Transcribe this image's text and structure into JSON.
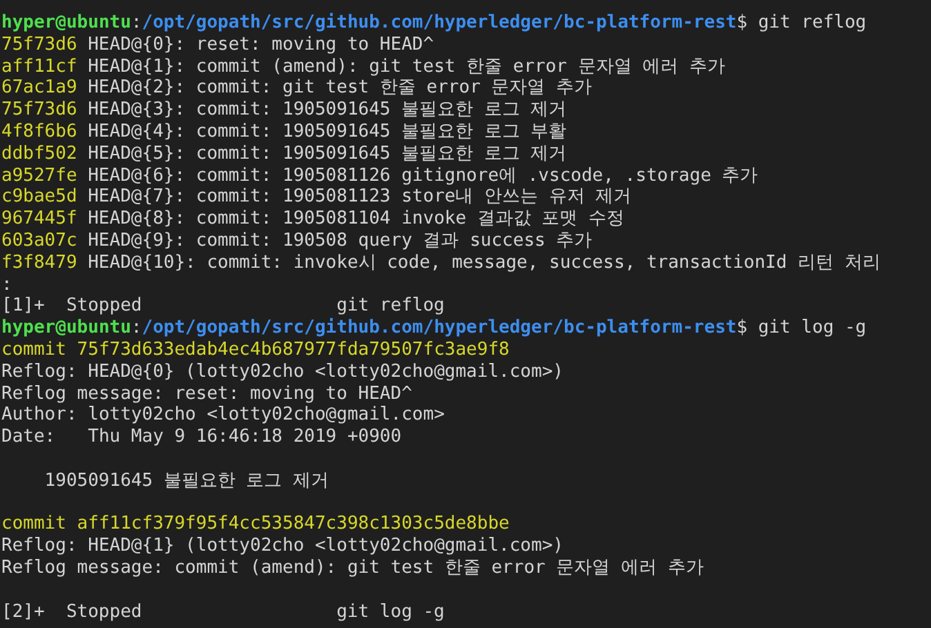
{
  "lines": [
    {
      "kind": "prompt",
      "user_host": "hyper@ubuntu",
      "separator": ":",
      "path": "/opt/gopath/src/github.com/hyperledger/bc-platform-rest",
      "symbol": "$",
      "command": "git reflog"
    },
    {
      "kind": "reflog",
      "hash": "75f73d6",
      "text": "HEAD@{0}: reset: moving to HEAD^"
    },
    {
      "kind": "reflog",
      "hash": "aff11cf",
      "text": "HEAD@{1}: commit (amend): git test 한줄 error 문자열 에러 추가"
    },
    {
      "kind": "reflog",
      "hash": "67ac1a9",
      "text": "HEAD@{2}: commit: git test 한줄 error 문자열 추가"
    },
    {
      "kind": "reflog",
      "hash": "75f73d6",
      "text": "HEAD@{3}: commit: 1905091645 불필요한 로그 제거"
    },
    {
      "kind": "reflog",
      "hash": "4f8f6b6",
      "text": "HEAD@{4}: commit: 1905091645 불필요한 로그 부활"
    },
    {
      "kind": "reflog",
      "hash": "ddbf502",
      "text": "HEAD@{5}: commit: 1905091645 불필요한 로그 제거"
    },
    {
      "kind": "reflog",
      "hash": "a9527fe",
      "text": "HEAD@{6}: commit: 1905081126 gitignore에 .vscode, .storage 추가"
    },
    {
      "kind": "reflog",
      "hash": "c9bae5d",
      "text": "HEAD@{7}: commit: 1905081123 store내 안쓰는 유저 제거"
    },
    {
      "kind": "reflog",
      "hash": "967445f",
      "text": "HEAD@{8}: commit: 1905081104 invoke 결과값 포맷 수정"
    },
    {
      "kind": "reflog",
      "hash": "603a07c",
      "text": "HEAD@{9}: commit: 190508 query 결과 success 추가"
    },
    {
      "kind": "reflog",
      "hash": "f3f8479",
      "text": "HEAD@{10}: commit: invoke시 code, message, success, transactionId 리턴 처리"
    },
    {
      "kind": "text",
      "text": ":"
    },
    {
      "kind": "job",
      "job": "[1]+",
      "status": "Stopped",
      "command": "git reflog"
    },
    {
      "kind": "prompt",
      "user_host": "hyper@ubuntu",
      "separator": ":",
      "path": "/opt/gopath/src/github.com/hyperledger/bc-platform-rest",
      "symbol": "$",
      "command": "git log -g"
    },
    {
      "kind": "commit",
      "text": "commit 75f73d633edab4ec4b687977fda79507fc3ae9f8"
    },
    {
      "kind": "text",
      "text": "Reflog: HEAD@{0} (lotty02cho <lotty02cho@gmail.com>)"
    },
    {
      "kind": "text",
      "text": "Reflog message: reset: moving to HEAD^"
    },
    {
      "kind": "text",
      "text": "Author: lotty02cho <lotty02cho@gmail.com>"
    },
    {
      "kind": "text",
      "text": "Date:   Thu May 9 16:46:18 2019 +0900"
    },
    {
      "kind": "blank"
    },
    {
      "kind": "message",
      "text": "1905091645 불필요한 로그 제거"
    },
    {
      "kind": "blank"
    },
    {
      "kind": "commit",
      "text": "commit aff11cf379f95f4cc535847c398c1303c5de8bbe"
    },
    {
      "kind": "text",
      "text": "Reflog: HEAD@{1} (lotty02cho <lotty02cho@gmail.com>)"
    },
    {
      "kind": "text",
      "text": "Reflog message: commit (amend): git test 한줄 error 문자열 에러 추가"
    },
    {
      "kind": "blank"
    },
    {
      "kind": "job",
      "job": "[2]+",
      "status": "Stopped",
      "command": "git log -g"
    }
  ]
}
